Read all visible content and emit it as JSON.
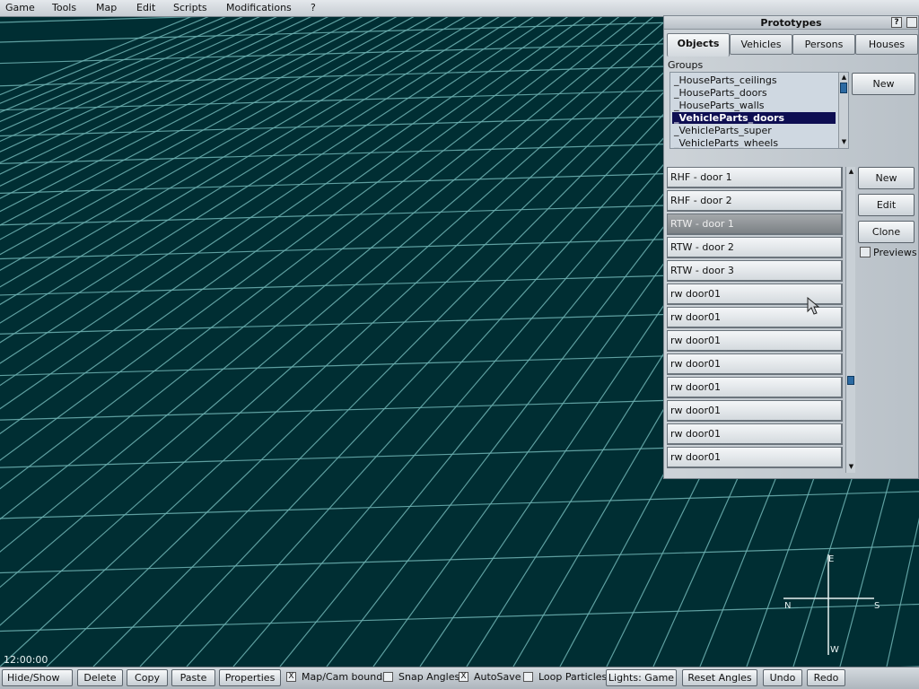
{
  "menu": [
    {
      "label": "Game"
    },
    {
      "label": "Tools"
    },
    {
      "label": "Map"
    },
    {
      "label": "Edit"
    },
    {
      "label": "Scripts"
    },
    {
      "label": "Modifications"
    },
    {
      "label": "?"
    }
  ],
  "panel": {
    "title": "Prototypes",
    "help_icon": "?",
    "tabs": [
      {
        "label": "Objects"
      },
      {
        "label": "Vehicles"
      },
      {
        "label": "Persons"
      },
      {
        "label": "Houses"
      }
    ],
    "groups_label": "Groups",
    "groups": [
      {
        "label": "_HouseParts_ceilings"
      },
      {
        "label": "_HouseParts_doors"
      },
      {
        "label": "_HouseParts_walls"
      },
      {
        "label": "_VehicleParts_doors"
      },
      {
        "label": "_VehicleParts_super"
      },
      {
        "label": "_VehicleParts_wheels"
      }
    ],
    "groups_new": "New",
    "items": [
      {
        "label": "RHF - door 1"
      },
      {
        "label": "RHF - door 2"
      },
      {
        "label": "RTW - door 1"
      },
      {
        "label": "RTW - door 2"
      },
      {
        "label": "RTW - door 3"
      },
      {
        "label": "rw door01"
      },
      {
        "label": "rw door01"
      },
      {
        "label": "rw door01"
      },
      {
        "label": "rw door01"
      },
      {
        "label": "rw door01"
      },
      {
        "label": "rw door01"
      },
      {
        "label": "rw door01"
      },
      {
        "label": "rw door01"
      }
    ],
    "buttons": {
      "new": "New",
      "edit": "Edit",
      "clone": "Clone"
    },
    "previews_label": "Previews"
  },
  "viewport": {
    "time": "12:00:00",
    "compass": {
      "north": "N",
      "south": "S",
      "east": "E",
      "west": "W"
    }
  },
  "toolbar": {
    "hide_show": "Hide/Show",
    "delete": "Delete",
    "copy": "Copy",
    "paste": "Paste",
    "properties": "Properties",
    "map_cam_bounds": "Map/Cam bounds",
    "snap_angles": "Snap Angles",
    "autosave": "AutoSave",
    "loop_particles": "Loop Particles",
    "lights": "Lights: Game",
    "reset_angles": "Reset Angles",
    "undo": "Undo",
    "redo": "Redo",
    "check_mark": "X"
  },
  "colors": {
    "grid_background": "#002e33",
    "grid_lines": "#6fb3b3",
    "selection": "#0e0e52"
  }
}
